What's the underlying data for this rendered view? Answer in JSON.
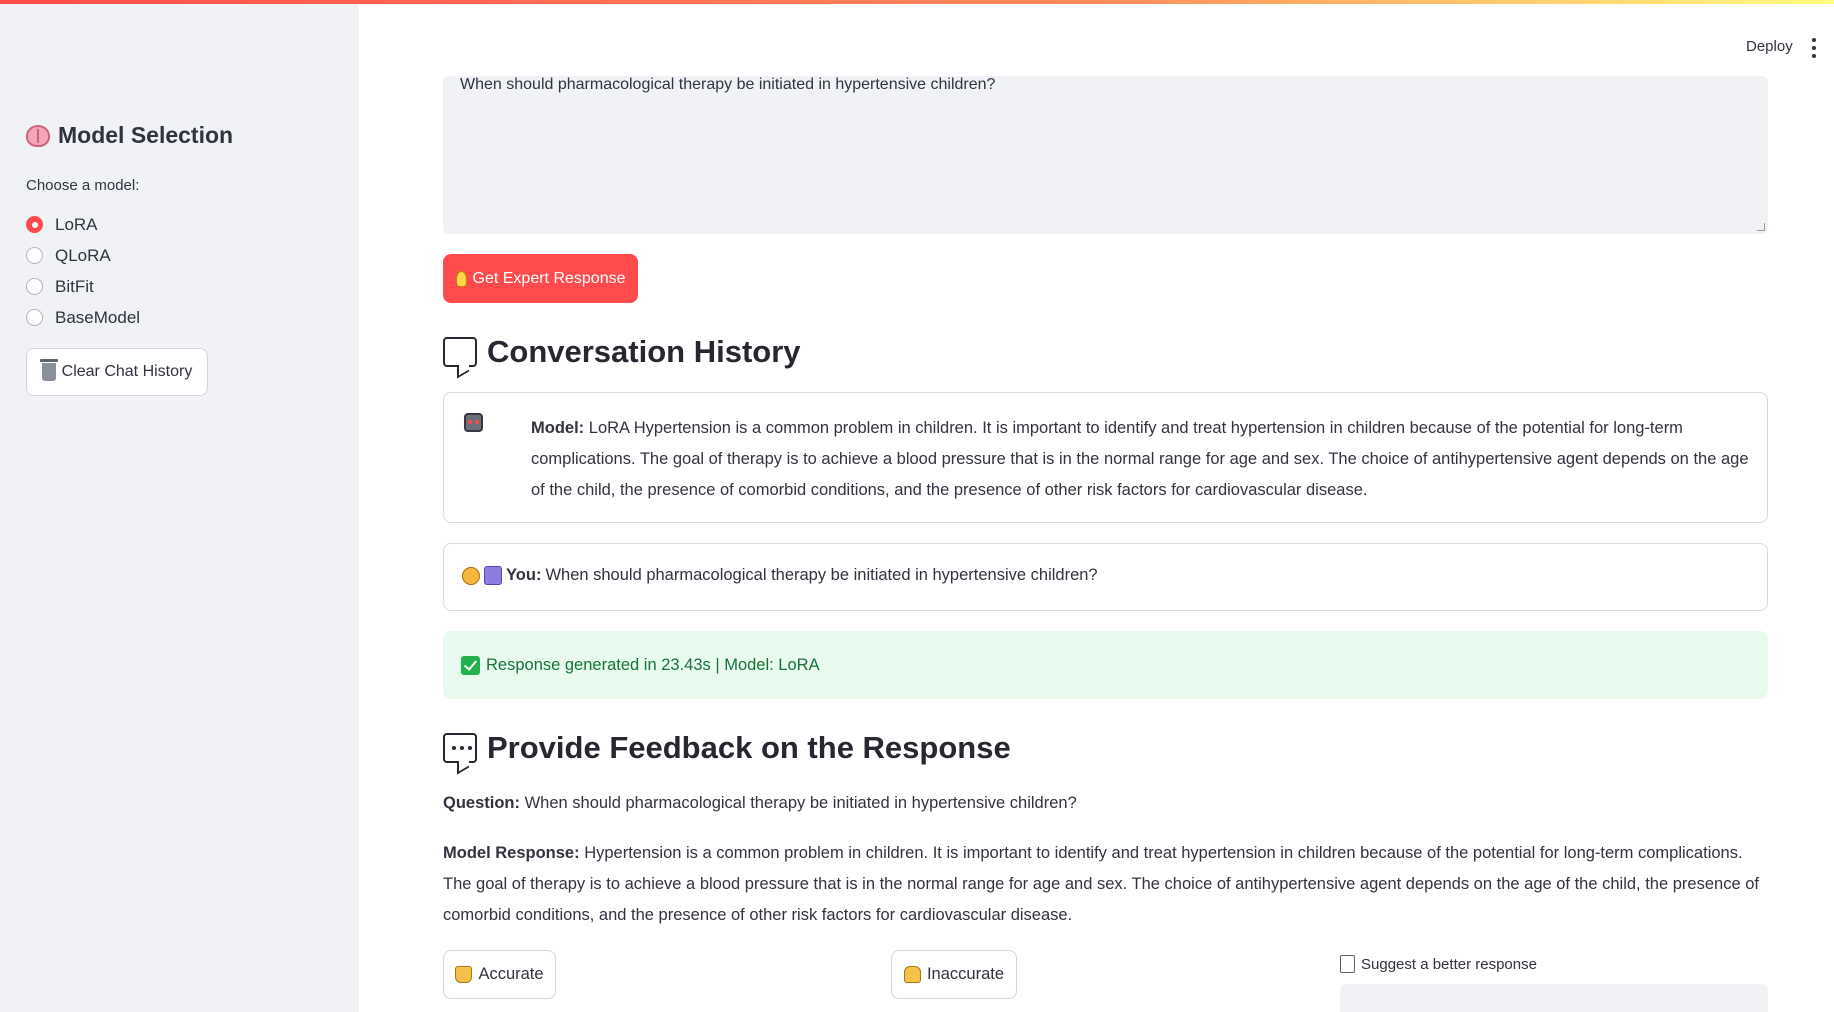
{
  "header": {
    "deploy_label": "Deploy"
  },
  "sidebar": {
    "title": "Model Selection",
    "choose_label": "Choose a model:",
    "models": [
      {
        "label": "LoRA",
        "selected": true
      },
      {
        "label": "QLoRA",
        "selected": false
      },
      {
        "label": "BitFit",
        "selected": false
      },
      {
        "label": "BaseModel",
        "selected": false
      }
    ],
    "clear_button": "Clear Chat History"
  },
  "main": {
    "question_input_value": "When should pharmacological therapy be initiated in hypertensive children?",
    "get_response_button": "Get Expert Response",
    "history_title": "Conversation History",
    "model_message": {
      "prefix": "Model:",
      "text": "LoRA Hypertension is a common problem in children. It is important to identify and treat hypertension in children because of the potential for long-term complications. The goal of therapy is to achieve a blood pressure that is in the normal range for age and sex. The choice of antihypertensive agent depends on the age of the child, the presence of comorbid conditions, and the presence of other risk factors for cardiovascular disease."
    },
    "user_message": {
      "prefix": "You:",
      "text": "When should pharmacological therapy be initiated in hypertensive children?"
    },
    "status": "Response generated in 23.43s | Model: LoRA",
    "feedback_title": "Provide Feedback on the Response",
    "question_label": "Question:",
    "question_text": "When should pharmacological therapy be initiated in hypertensive children?",
    "response_label": "Model Response:",
    "response_text": "Hypertension is a common problem in children. It is important to identify and treat hypertension in children because of the potential for long-term complications. The goal of therapy is to achieve a blood pressure that is in the normal range for age and sex. The choice of antihypertensive agent depends on the age of the child, the presence of comorbid conditions, and the presence of other risk factors for cardiovascular disease.",
    "accurate_button": "Accurate",
    "inaccurate_button": "Inaccurate",
    "suggest_label": "Suggest a better response"
  },
  "colors": {
    "primary": "#ff4b4b",
    "sidebar_bg": "#f0f2f6",
    "success_bg": "#e8f9ee",
    "success_text": "#17733a"
  },
  "icons": [
    "brain-icon",
    "trash-icon",
    "lightbulb-icon",
    "speech-bubble-icon",
    "robot-icon",
    "person-icon",
    "medic-icon",
    "check-icon",
    "dots-bubble-icon",
    "thumbs-up-icon",
    "thumbs-down-icon",
    "memo-icon",
    "kebab-menu-icon"
  ]
}
